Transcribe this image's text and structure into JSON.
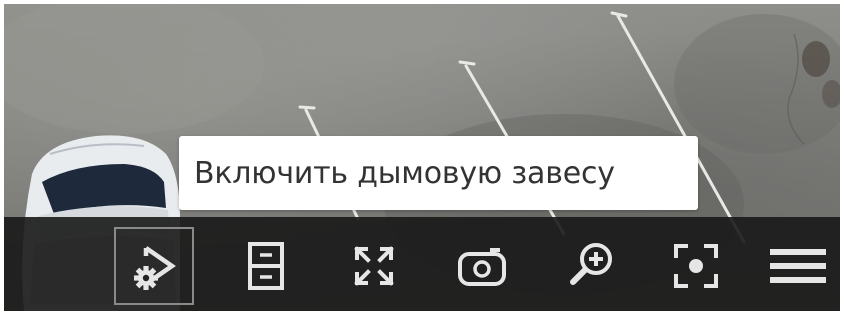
{
  "tooltip": {
    "text": "Включить дымовую завесу"
  },
  "toolbar": {
    "buttons": [
      {
        "icon": "smoke-screen-icon",
        "active": true
      },
      {
        "icon": "archive-icon",
        "active": false
      },
      {
        "icon": "fullscreen-icon",
        "active": false
      },
      {
        "icon": "camera-snapshot-icon",
        "active": false
      },
      {
        "icon": "zoom-in-icon",
        "active": false
      },
      {
        "icon": "focus-point-icon",
        "active": false
      },
      {
        "icon": "menu-icon",
        "active": false
      }
    ]
  },
  "colors": {
    "toolbar_bg": "#181818",
    "icon": "#e6e6e6",
    "tooltip_bg": "#ffffff",
    "tooltip_text": "#333333"
  }
}
